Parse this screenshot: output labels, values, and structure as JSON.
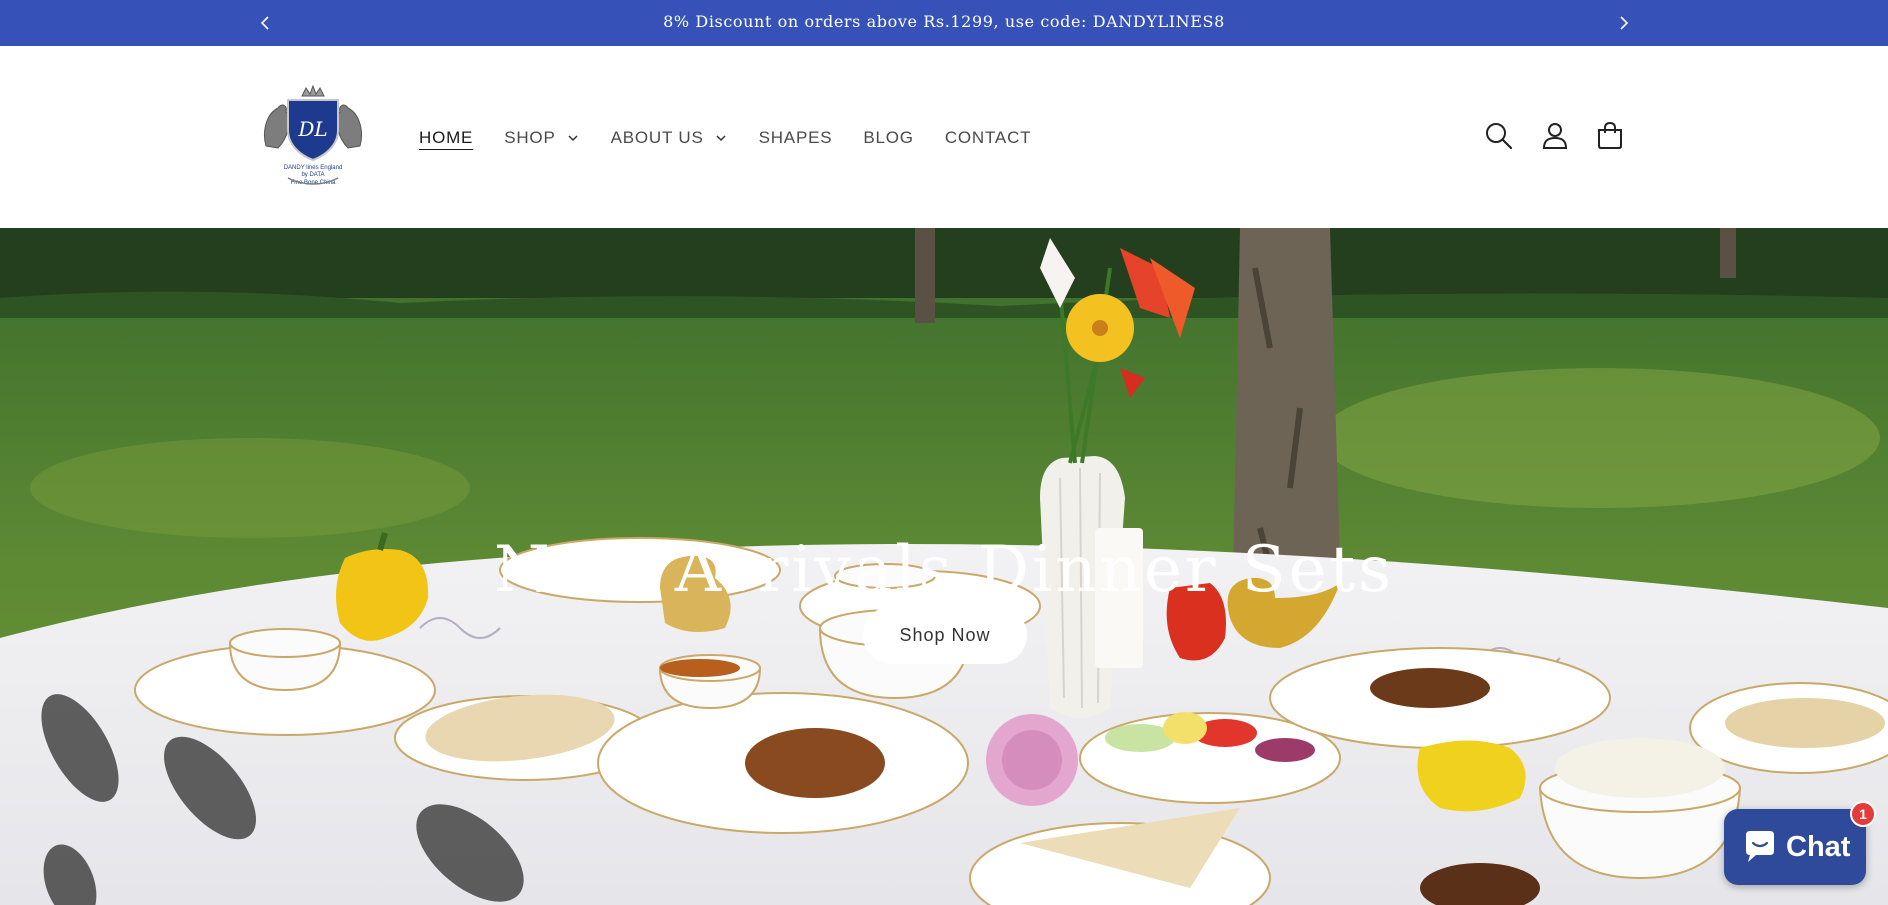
{
  "announcement": {
    "text": "8% Discount on orders above Rs.1299, use code: DANDYLINES8",
    "prev_icon": "chevron-left-icon",
    "next_icon": "chevron-right-icon"
  },
  "brand": {
    "monogram": "DL",
    "line1": "DANDY lines England",
    "line2": "by DATA",
    "line3": "Fine Bone China",
    "color": "#1d3a8f"
  },
  "nav": {
    "items": [
      {
        "label": "HOME",
        "active": true
      },
      {
        "label": "SHOP",
        "dropdown": true
      },
      {
        "label": "ABOUT US",
        "dropdown": true
      },
      {
        "label": "SHAPES"
      },
      {
        "label": "BLOG"
      },
      {
        "label": "CONTACT"
      }
    ]
  },
  "header_icons": [
    "search-icon",
    "account-icon",
    "cart-icon"
  ],
  "hero": {
    "title": "New Arrivals Dinner Sets",
    "cta_label": "Shop Now"
  },
  "chat": {
    "label": "Chat",
    "badge": "1",
    "icon": "chat-bubble-icon"
  },
  "colors": {
    "announcement_bg": "#3652b8",
    "chat_bg": "#2f4a9a",
    "badge": "#e33b3b"
  }
}
